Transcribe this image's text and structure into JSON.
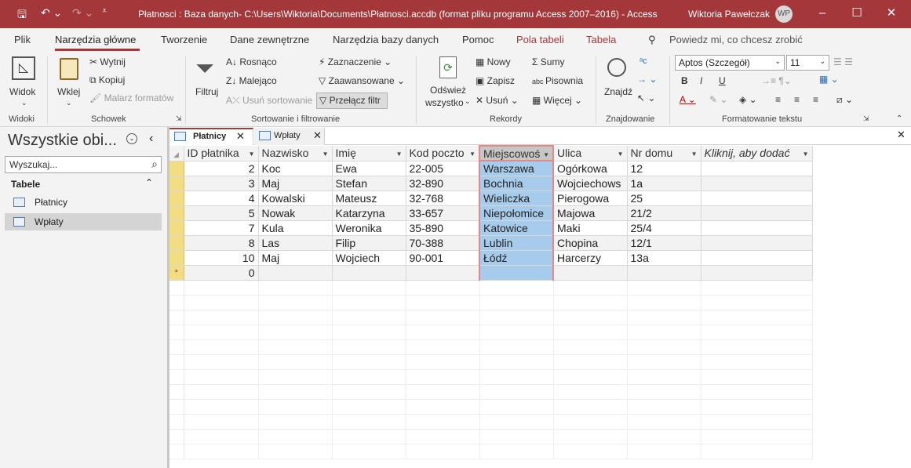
{
  "title_bar": {
    "title": "Płatnosci : Baza danych- C:\\Users\\Wiktoria\\Documents\\Płatnosci.accdb (format pliku programu Access 2007–2016)  -  Access",
    "user_name": "Wiktoria Pawełczak",
    "user_initials": "WP",
    "accent_color": "#a4373a"
  },
  "menu_tabs": [
    "Plik",
    "Narzędzia główne",
    "Tworzenie",
    "Dane zewnętrzne",
    "Narzędzia bazy danych",
    "Pomoc",
    "Pola tabeli",
    "Tabela"
  ],
  "tell_me": "Powiedz mi, co chcesz zrobić",
  "ribbon": {
    "widoki": {
      "label": "Widoki",
      "view_btn": "Widok"
    },
    "schowek": {
      "label": "Schowek",
      "paste": "Wklej",
      "cut": "Wytnij",
      "copy": "Kopiuj",
      "painter": "Malarz formatów"
    },
    "sort_filter": {
      "label": "Sortowanie i filtrowanie",
      "filter": "Filtruj",
      "asc": "Rosnąco",
      "desc": "Malejąco",
      "clear_sort": "Usuń sortowanie",
      "selection": "Zaznaczenie",
      "advanced": "Zaawansowane",
      "toggle": "Przełącz filtr"
    },
    "records": {
      "label": "Rekordy",
      "refresh_line1": "Odśwież",
      "refresh_line2": "wszystko",
      "new": "Nowy",
      "save": "Zapisz",
      "delete": "Usuń",
      "totals": "Sumy",
      "spelling": "Pisownia",
      "more": "Więcej"
    },
    "find": {
      "label": "Znajdowanie",
      "find_btn": "Znajdź"
    },
    "text_format": {
      "label": "Formatowanie tekstu",
      "font": "Aptos (Szczegół)",
      "size": "11"
    }
  },
  "nav": {
    "header": "Wszystkie obi...",
    "search_placeholder": "Wyszukaj...",
    "group": "Tabele",
    "items": [
      "Płatnicy",
      "Wpłaty"
    ]
  },
  "doc_tabs": [
    "Płatnicy",
    "Wpłaty"
  ],
  "table": {
    "columns": [
      "ID płatnika",
      "Nazwisko",
      "Imię",
      "Kod poczto",
      "Miejscowoś",
      "Ulica",
      "Nr domu",
      "Kliknij, aby dodać"
    ],
    "rows": [
      [
        "2",
        "Koc",
        "Ewa",
        "22-005",
        "Warszawa",
        "Ogórkowa",
        "12"
      ],
      [
        "3",
        "Maj",
        "Stefan",
        "32-890",
        "Bochnia",
        "Wojciechows",
        "1a"
      ],
      [
        "4",
        "Kowalski",
        "Mateusz",
        "32-768",
        "Wieliczka",
        "Pierogowa",
        "25"
      ],
      [
        "5",
        "Nowak",
        "Katarzyna",
        "33-657",
        "Niepołomice",
        "Majowa",
        "21/2"
      ],
      [
        "7",
        "Kula",
        "Weronika",
        "35-890",
        "Katowice",
        "Maki",
        "25/4"
      ],
      [
        "8",
        "Las",
        "Filip",
        "70-388",
        "Lublin",
        "Chopina",
        "12/1"
      ],
      [
        "10",
        "Maj",
        "Wojciech",
        "90-001",
        "Łódź",
        "Harcerzy",
        "13a"
      ]
    ],
    "new_row_id": "0",
    "new_row_marker": "*"
  }
}
